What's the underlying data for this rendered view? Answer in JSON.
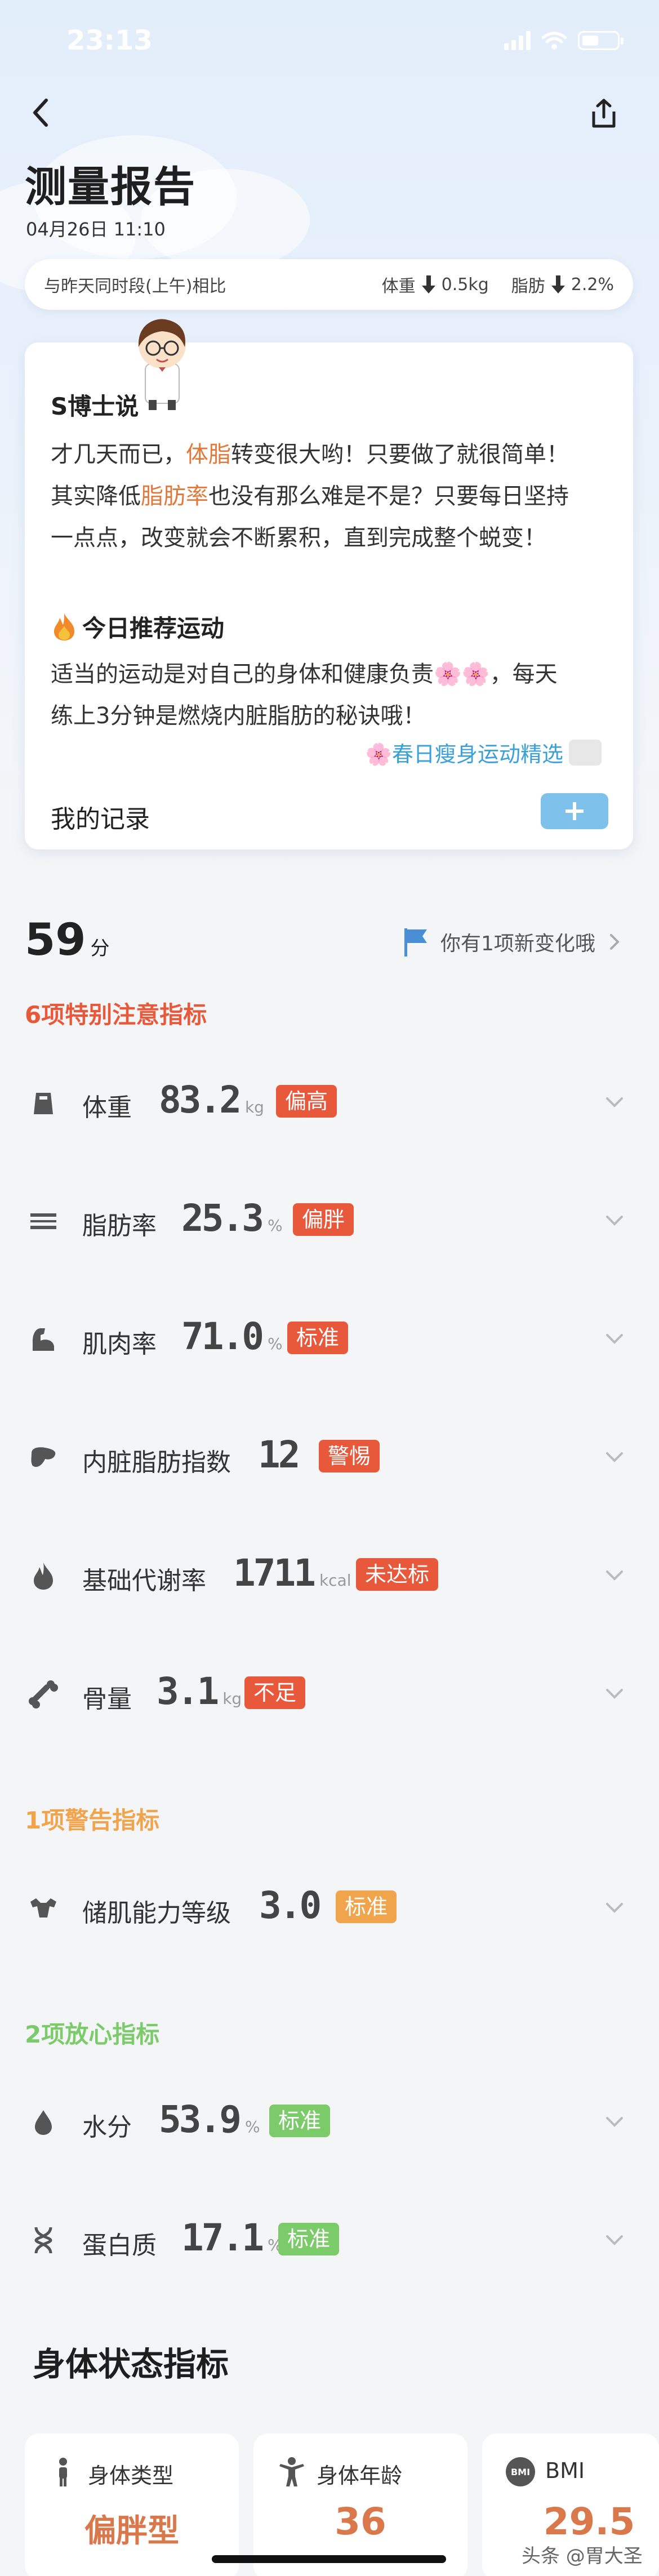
{
  "status_bar": {
    "time": "23:13"
  },
  "header": {
    "title": "测量报告",
    "date": "04月26日 11:10"
  },
  "compare": {
    "label": "与昨天同时段(上午)相比",
    "weight_label": "体重",
    "weight_change": "0.5kg",
    "fat_label": "脂肪",
    "fat_change": "2.2%"
  },
  "dr_card": {
    "title": "S博士说",
    "p1_a": "才几天而已，",
    "p1_hl1": "体脂",
    "p1_b": "转变很大哟！只要做了就很简单！",
    "p2_a": "其实降低",
    "p2_hl2": "脂肪率",
    "p2_b": "也没有那么难是不是？只要每日坚持",
    "p3": "一点点，改变就会不断累积，直到完成整个蜕变！",
    "exercise_title": "今日推荐运动",
    "exercise_p1": "适当的运动是对自己的身体和健康负责🌸🌸，每天",
    "exercise_p2": "练上3分钟是燃烧内脏脂肪的秘诀哦！",
    "link": "🌸春日瘦身运动精选",
    "record_label": "我的记录"
  },
  "score": {
    "value": "59",
    "unit": "分",
    "changes_text": "你有1项新变化哦"
  },
  "groups": {
    "attention": "6项特别注意指标",
    "warning": "1项警告指标",
    "safe": "2项放心指标"
  },
  "metrics": [
    {
      "name": "体重",
      "value": "83.2",
      "unit": "kg",
      "badge": "偏高",
      "icon": "scale-icon"
    },
    {
      "name": "脂肪率",
      "value": "25.3",
      "unit": "%",
      "badge": "偏胖",
      "icon": "fat-layers-icon"
    },
    {
      "name": "肌肉率",
      "value": "71.0",
      "unit": "%",
      "badge": "标准",
      "icon": "muscle-arm-icon"
    },
    {
      "name": "内脏脂肪指数",
      "value": "12",
      "unit": "",
      "badge": "警惕",
      "icon": "organ-icon"
    },
    {
      "name": "基础代谢率",
      "value": "1711",
      "unit": "kcal",
      "badge": "未达标",
      "icon": "flame-icon"
    },
    {
      "name": "骨量",
      "value": "3.1",
      "unit": "kg",
      "badge": "不足",
      "icon": "bone-icon"
    },
    {
      "name": "储肌能力等级",
      "value": "3.0",
      "unit": "",
      "badge": "标准",
      "icon": "muscle-storage-icon"
    },
    {
      "name": "水分",
      "value": "53.9",
      "unit": "%",
      "badge": "标准",
      "icon": "water-drop-icon"
    },
    {
      "name": "蛋白质",
      "value": "17.1",
      "unit": "%",
      "badge": "标准",
      "icon": "dna-icon"
    }
  ],
  "colors": {
    "badge_red": "#e8593c",
    "badge_orange": "#f0a44b",
    "badge_green": "#7ccb6b",
    "accent_blue": "#3aa0d8"
  },
  "body_status": {
    "title": "身体状态指标",
    "cards": [
      {
        "label": "身体类型",
        "value": "偏胖型"
      },
      {
        "label": "身体年龄",
        "value": "36"
      },
      {
        "label": "BMI",
        "value": "29.5"
      }
    ]
  },
  "watermark": "头条 @胃大圣"
}
